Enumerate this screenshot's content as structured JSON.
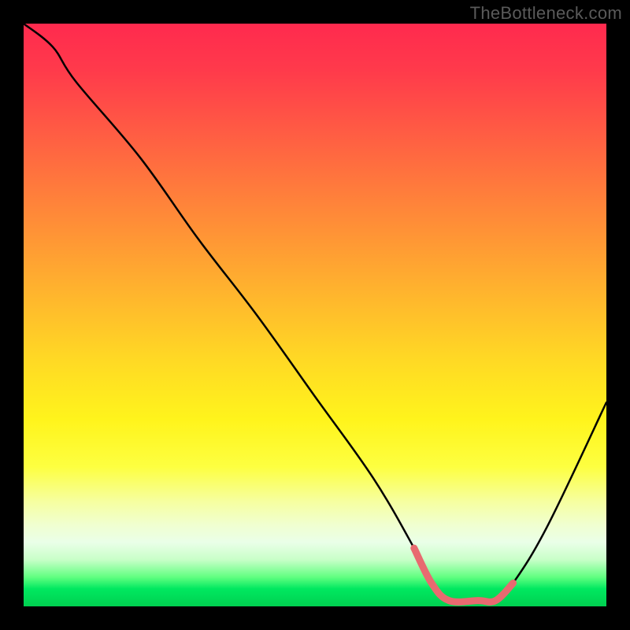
{
  "watermark": "TheBottleneck.com",
  "chart_data": {
    "type": "line",
    "title": "",
    "xlabel": "",
    "ylabel": "",
    "xlim": [
      0,
      100
    ],
    "ylim": [
      0,
      100
    ],
    "grid": false,
    "series": [
      {
        "name": "main-curve",
        "color": "#000000",
        "x": [
          0,
          5,
          9,
          20,
          30,
          40,
          50,
          60,
          67,
          70,
          73,
          78,
          81,
          84,
          90,
          100
        ],
        "values": [
          100,
          96,
          90,
          77,
          63,
          50,
          36,
          22,
          10,
          4,
          1,
          1,
          1,
          4,
          14,
          35
        ]
      },
      {
        "name": "optimal-zone",
        "color": "#e86a70",
        "x": [
          67,
          70,
          73,
          78,
          81,
          84
        ],
        "values": [
          10,
          4,
          1,
          1,
          1,
          4
        ]
      }
    ],
    "gradient_stops": [
      {
        "pos": 0,
        "color": "#ff2a4e"
      },
      {
        "pos": 18,
        "color": "#ff5a44"
      },
      {
        "pos": 38,
        "color": "#ff9a34"
      },
      {
        "pos": 58,
        "color": "#ffda24"
      },
      {
        "pos": 76,
        "color": "#fdff40"
      },
      {
        "pos": 89,
        "color": "#eaffe8"
      },
      {
        "pos": 95,
        "color": "#60ff80"
      },
      {
        "pos": 100,
        "color": "#00d050"
      }
    ]
  }
}
